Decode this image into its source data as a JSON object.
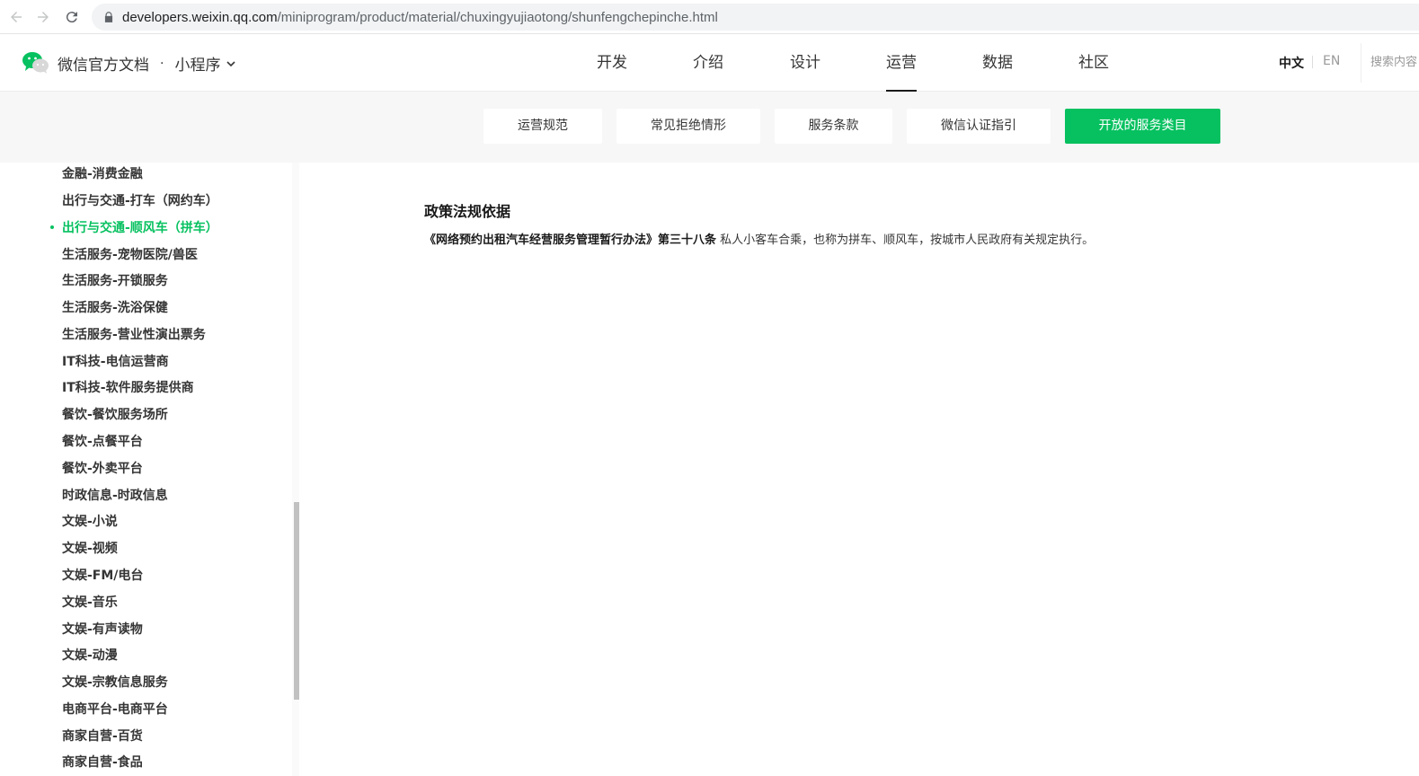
{
  "browser": {
    "url_host": "developers.weixin.qq.com",
    "url_path": "/miniprogram/product/material/chuxingyujiaotong/shunfengchepinche.html"
  },
  "header": {
    "brand": "微信官方文档",
    "dot": "·",
    "product": "小程序",
    "nav": [
      "开发",
      "介绍",
      "设计",
      "运营",
      "数据",
      "社区"
    ],
    "active_nav": "运营",
    "lang_zh": "中文",
    "lang_en": "EN",
    "search_placeholder": "搜索内容"
  },
  "subnav": {
    "tabs": [
      "运营规范",
      "常见拒绝情形",
      "服务条款",
      "微信认证指引",
      "开放的服务类目"
    ],
    "active": "开放的服务类目"
  },
  "sidebar": {
    "items": [
      "金融-消费金融",
      "出行与交通-打车（网约车）",
      "出行与交通-顺风车（拼车）",
      "生活服务-宠物医院/兽医",
      "生活服务-开锁服务",
      "生活服务-洗浴保健",
      "生活服务-营业性演出票务",
      "IT科技-电信运营商",
      "IT科技-软件服务提供商",
      "餐饮-餐饮服务场所",
      "餐饮-点餐平台",
      "餐饮-外卖平台",
      "时政信息-时政信息",
      "文娱-小说",
      "文娱-视频",
      "文娱-FM/电台",
      "文娱-音乐",
      "文娱-有声读物",
      "文娱-动漫",
      "文娱-宗教信息服务",
      "电商平台-电商平台",
      "商家自营-百货",
      "商家自营-食品"
    ],
    "active_index": 2
  },
  "content": {
    "section_title": "政策法规依据",
    "law_name": "《网络预约出租汽车经营服务管理暂行办法》第三十八条",
    "law_text": " 私人小客车合乘，也称为拼车、顺风车，按城市人民政府有关规定执行。"
  },
  "colors": {
    "accent": "#07c160",
    "subnav_bg": "#f7f7f7"
  }
}
